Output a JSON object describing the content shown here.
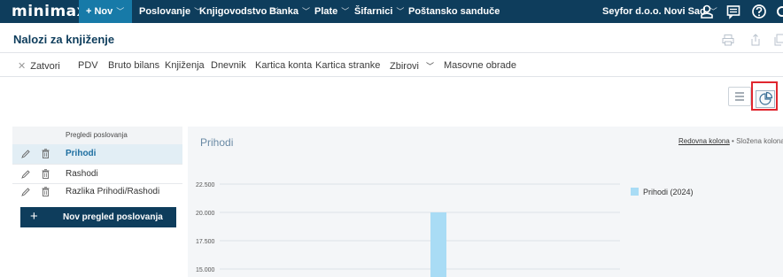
{
  "topbar": {
    "logo": "minimax",
    "new_button": "+ Nov",
    "menu": [
      {
        "label": "Poslovanje"
      },
      {
        "label": "Knjigovodstvo"
      },
      {
        "label": "Banka"
      },
      {
        "label": "Plate"
      },
      {
        "label": "Šifarnici"
      },
      {
        "label": "Poštansko sanduče"
      }
    ],
    "organization": "Seyfor d.o.o. Novi Sad",
    "icons": [
      "user-icon",
      "messages-icon",
      "help-icon"
    ]
  },
  "page": {
    "title": "Nalozi za knjiženje",
    "header_icons": [
      "print-icon",
      "export-icon",
      "copy-icon"
    ]
  },
  "toolbar": {
    "close": "Zatvori",
    "items": [
      "PDV",
      "Bruto bilans",
      "Knjiženja",
      "Dnevnik",
      "Kartica konta",
      "Kartica stranke"
    ],
    "zbirovi": "Zbirovi",
    "masovne": "Masovne obrade"
  },
  "view_switch": {
    "list_icon": "list-icon",
    "chart_icon": "pie-chart-icon"
  },
  "overviews": {
    "header": "Pregledi poslovanja",
    "items": [
      {
        "label": "Prihodi",
        "selected": true
      },
      {
        "label": "Rashodi",
        "selected": false
      },
      {
        "label": "Razlika Prihodi/Rashodi",
        "selected": false
      }
    ],
    "add_button": "Nov pregled poslovanja"
  },
  "chart": {
    "mode_active": "Redovna kolona",
    "mode_separator": " • ",
    "mode_other": "Složena kolona",
    "accent": "#a9dcf5"
  },
  "chart_data": {
    "type": "bar",
    "title": "Prihodi",
    "series": [
      {
        "name": "Prihodi (2024)",
        "values": [
          null,
          20000
        ]
      }
    ],
    "categories": [
      "",
      ""
    ],
    "y_ticks": [
      "22.500",
      "20.000",
      "17.500",
      "15.000"
    ],
    "y_tick_values": [
      22500,
      20000,
      17500,
      15000
    ],
    "ylim_visible": [
      15000,
      22500
    ],
    "legend_position": "right",
    "grid": true
  }
}
